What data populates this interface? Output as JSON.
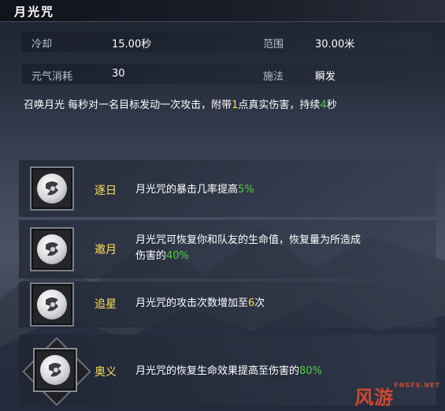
{
  "skill": {
    "title": "月光咒",
    "stats": [
      {
        "label": "冷却",
        "value": "15.00秒"
      },
      {
        "label": "范围",
        "value": "30.00米"
      },
      {
        "label": "元气消耗",
        "value": "30"
      },
      {
        "label": "施法",
        "value": "瞬发"
      }
    ],
    "description": {
      "part1": "召唤月光 每秒对一名目标发动一次攻击，附带",
      "num1": "1",
      "part2": "点真实伤害，持续",
      "num2": "4",
      "part3": "秒"
    }
  },
  "talents": [
    {
      "icon": "moon-spell-icon",
      "name": "逐日",
      "desc_text": "月光咒的暴击几率提高",
      "desc_value": "5%"
    },
    {
      "icon": "moon-spell-icon",
      "name": "邀月",
      "desc_text_line1": "月光咒可恢复你和队友的生命值，恢复量为所造成",
      "desc_text_line2": "伤害的",
      "desc_value": "40%"
    },
    {
      "icon": "moon-spell-icon",
      "name": "追星",
      "desc_text": "月光咒的攻击次数增加至",
      "desc_value": "6",
      "desc_suffix": "次"
    },
    {
      "icon": "moon-spell-icon",
      "name": "奥义",
      "desc_text": "月光咒的恢复生命效果提高至伤害的",
      "desc_value": "80%"
    }
  ],
  "watermark": {
    "text": "风游",
    "small": "FNSFS.NET"
  },
  "colors": {
    "highlight_green": "#4fd13a",
    "highlight_yellow": "#ffde3a",
    "talent_name": "#ffe25a"
  }
}
